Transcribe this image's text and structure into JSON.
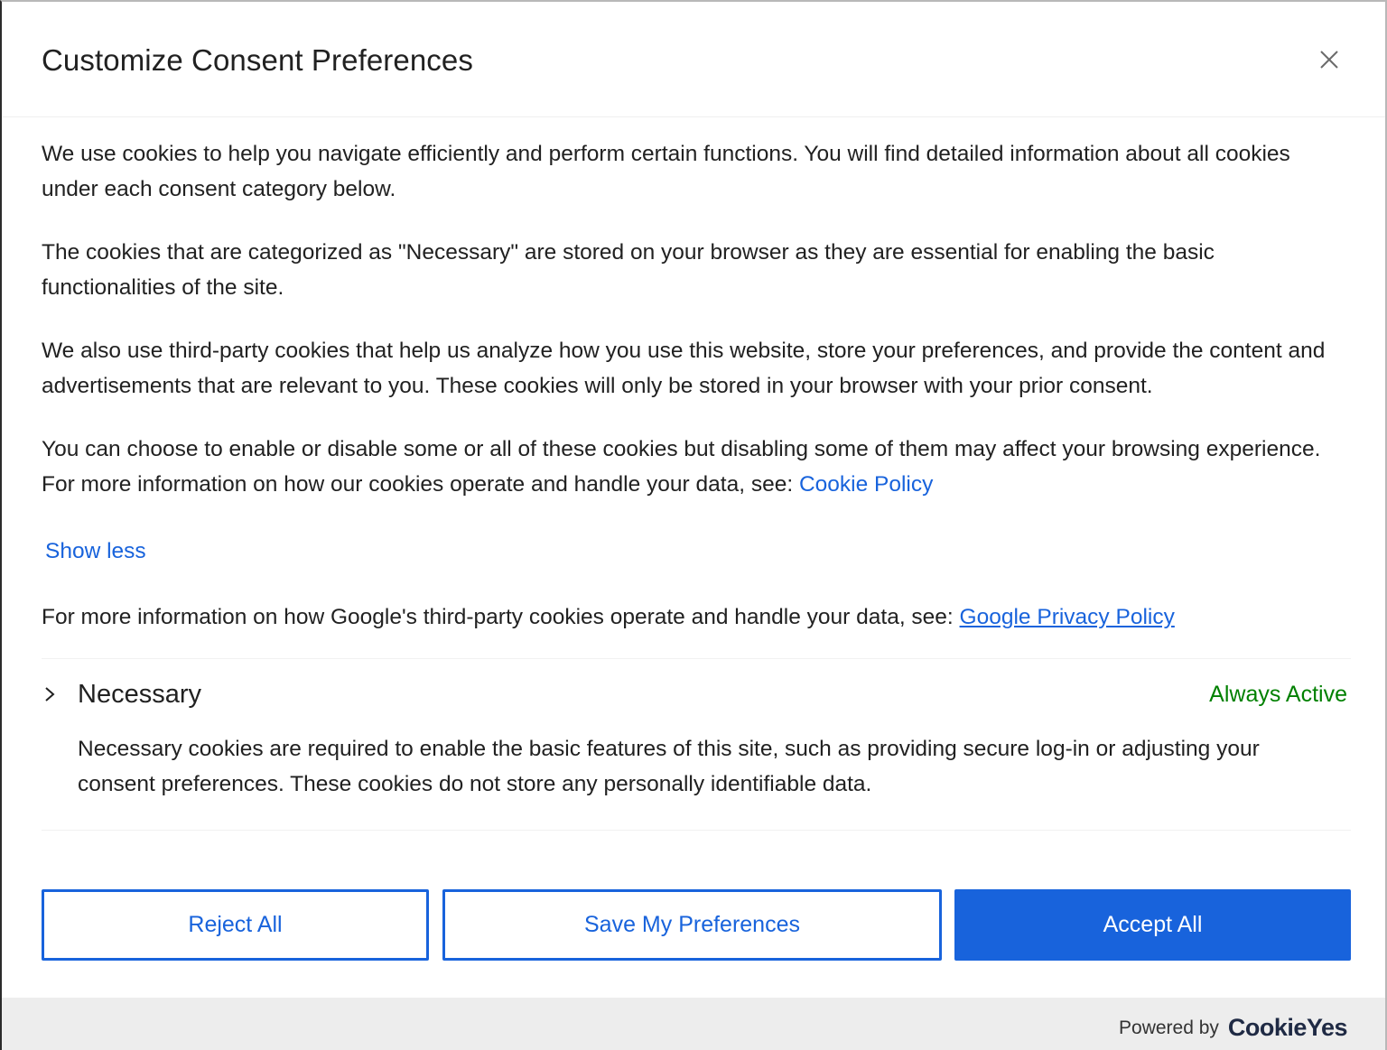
{
  "dialog": {
    "title": "Customize Consent Preferences",
    "close_label": "×"
  },
  "description": {
    "p1": "We use cookies to help you navigate efficiently and perform certain functions. You will find detailed information about all cookies under each consent category below.",
    "p2": "The cookies that are categorized as \"Necessary\" are stored on your browser as they are essential for enabling the basic functionalities of the site.",
    "p3": "We also use third-party cookies that help us analyze how you use this website, store your preferences, and provide the content and advertisements that are relevant to you. These cookies will only be stored in your browser with your prior consent.",
    "p4_text": "You can choose to enable or disable some or all of these cookies but disabling some of them may affect your browsing experience. For more information on how our cookies operate and handle your data, see: ",
    "p4_link": "Cookie Policy",
    "show_less": "Show less",
    "google_text": "For more information on how Google's third-party cookies operate and handle your data, see: ",
    "google_link": "Google Privacy Policy"
  },
  "categories": [
    {
      "name": "Necessary",
      "status": "Always Active",
      "description": "Necessary cookies are required to enable the basic features of this site, such as providing secure log-in or adjusting your consent preferences. These cookies do not store any personally identifiable data."
    }
  ],
  "buttons": {
    "reject": "Reject All",
    "save": "Save My Preferences",
    "accept": "Accept All"
  },
  "footer": {
    "powered_by": "Powered by",
    "brand": "CookieYes"
  },
  "colors": {
    "accent": "#1863dc",
    "always_active": "#008000",
    "footer_bg": "#ededed"
  },
  "icons": {
    "close": "close-icon",
    "expand": "chevron-right-icon"
  }
}
